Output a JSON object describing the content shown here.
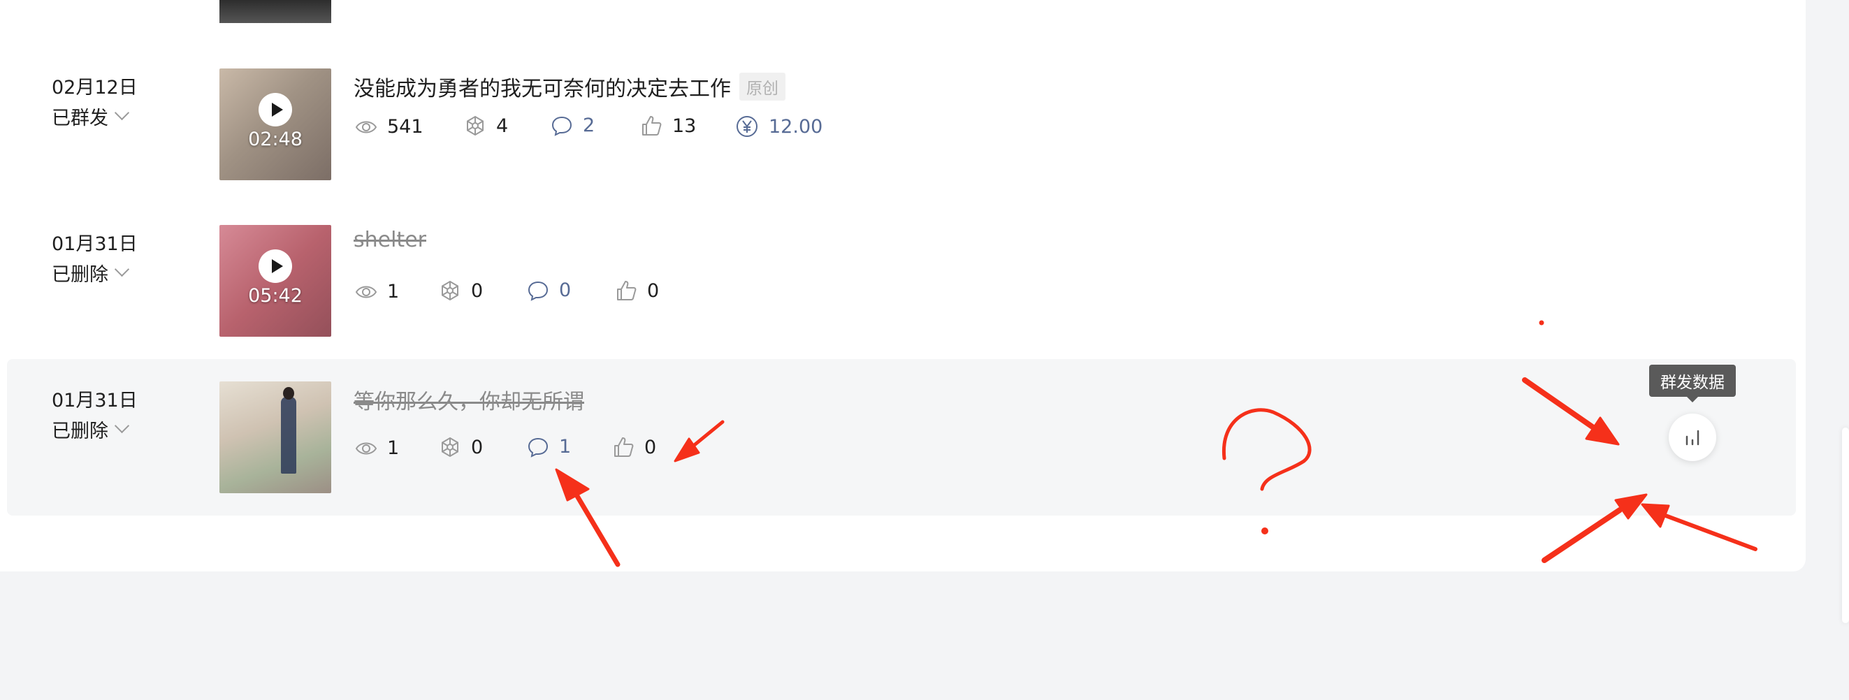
{
  "rows": [
    {
      "date": "02月12日",
      "status": "已群发",
      "title": "没能成为勇者的我无可奈何的决定去工作",
      "tag": "原创",
      "duration": "02:48",
      "views": "541",
      "shares": "4",
      "comments": "2",
      "likes": "13",
      "reward": "12.00",
      "thumb_colors": [
        "#b8a89a",
        "#8e8078"
      ]
    },
    {
      "date": "01月31日",
      "status": "已删除",
      "title": "shelter",
      "duration": "05:42",
      "views": "1",
      "shares": "0",
      "comments": "0",
      "likes": "0",
      "thumb_colors": [
        "#c7737f",
        "#9b5a63"
      ]
    },
    {
      "date": "01月31日",
      "status": "已删除",
      "title": "等你那么久，你却无所谓",
      "views": "1",
      "shares": "0",
      "comments": "1",
      "likes": "0",
      "thumb_colors": [
        "#d9cfc3",
        "#b5a08f"
      ]
    }
  ],
  "tooltip": "群发数据",
  "icons": {
    "views": "eye-icon",
    "shares": "share-flower-icon",
    "comments": "comment-bubble-icon",
    "likes": "thumbs-up-icon",
    "reward": "yuan-coin-icon",
    "chart": "bar-chart-icon"
  },
  "colors": {
    "accent_blue": "#576b95",
    "annotation_red": "#f5301a",
    "deleted_text": "#8a8a8a"
  }
}
